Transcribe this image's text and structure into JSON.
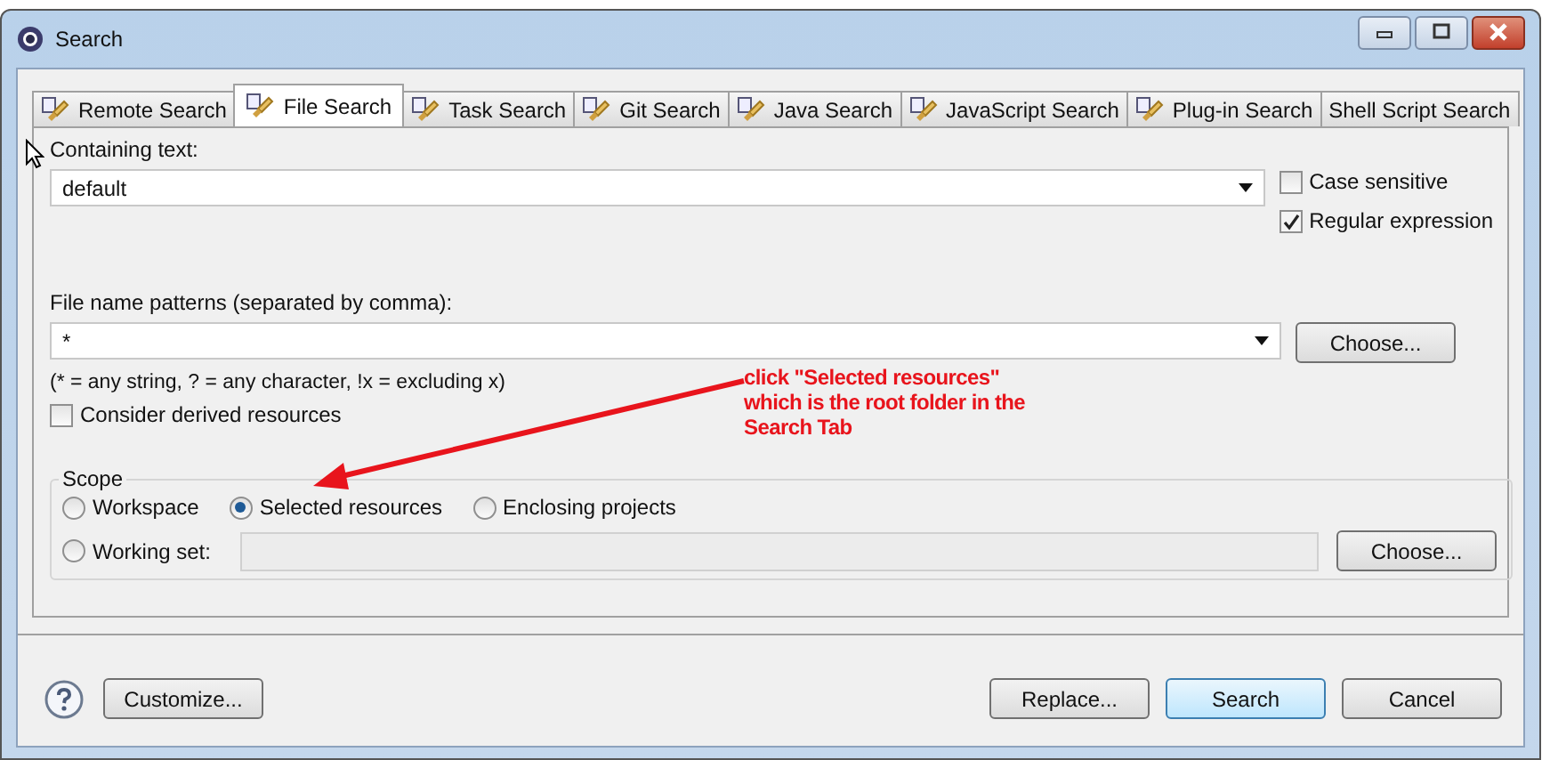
{
  "window": {
    "title": "Search"
  },
  "tabs": [
    {
      "label": "Remote Search",
      "selected": false,
      "has_icon": true
    },
    {
      "label": "File Search",
      "selected": true,
      "has_icon": true
    },
    {
      "label": "Task Search",
      "selected": false,
      "has_icon": true
    },
    {
      "label": "Git Search",
      "selected": false,
      "has_icon": true
    },
    {
      "label": "Java Search",
      "selected": false,
      "has_icon": true
    },
    {
      "label": "JavaScript Search",
      "selected": false,
      "has_icon": true
    },
    {
      "label": "Plug-in Search",
      "selected": false,
      "has_icon": true
    },
    {
      "label": "Shell Script Search",
      "selected": false,
      "has_icon": false
    }
  ],
  "containing_text": {
    "label": "Containing text:",
    "value": "default"
  },
  "options": [
    {
      "label": "Case sensitive",
      "checked": false
    },
    {
      "label": "Regular expression",
      "checked": true
    }
  ],
  "file_patterns": {
    "label": "File name patterns (separated by comma):",
    "value": "*",
    "button": "Choose...",
    "hint": "(* = any string, ? = any character, !x = excluding x)"
  },
  "derived": {
    "label": "Consider derived resources",
    "checked": false
  },
  "scope": {
    "title": "Scope",
    "radios": [
      {
        "label": "Workspace",
        "selected": false
      },
      {
        "label": "Selected resources",
        "selected": true
      },
      {
        "label": "Enclosing projects",
        "selected": false
      }
    ],
    "working_set": {
      "label": "Working set:",
      "selected": false,
      "button": "Choose..."
    }
  },
  "annotation": {
    "text": "click \"Selected resources\"\nwhich is the root folder in the\nSearch Tab"
  },
  "buttons": [
    {
      "label": "Customize...",
      "default": false
    },
    {
      "label": "Replace...",
      "default": false
    },
    {
      "label": "Search",
      "default": true
    },
    {
      "label": "Cancel",
      "default": false
    }
  ]
}
